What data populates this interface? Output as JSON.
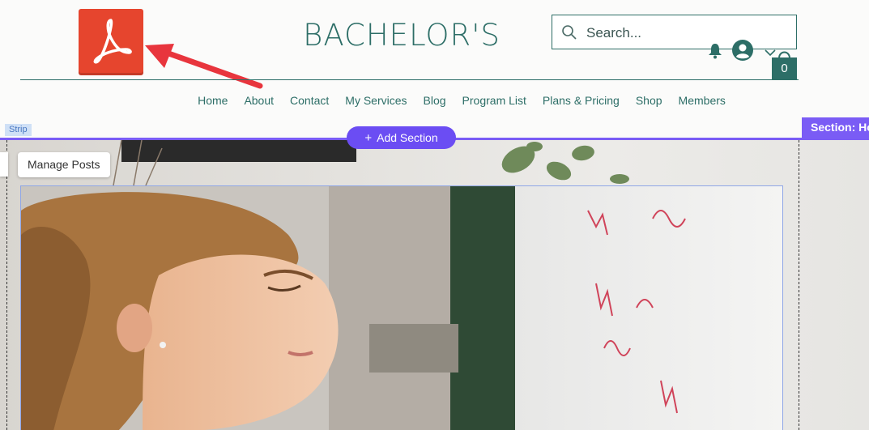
{
  "header": {
    "site_title": "BACHELOR'S",
    "logo_icon": "adobe-acrobat-pdf-icon",
    "search": {
      "placeholder": "Search...",
      "value": ""
    },
    "cart_count": "0",
    "nav": [
      "Home",
      "About",
      "Contact",
      "My Services",
      "Blog",
      "Program List",
      "Plans & Pricing",
      "Shop",
      "Members"
    ]
  },
  "editor": {
    "strip_label": "Strip",
    "add_section_label": "Add Section",
    "section_label": "Section: Ho",
    "manage_posts_label": "Manage Posts"
  },
  "colors": {
    "brand": "#2d6e67",
    "logo_red": "#e6452e",
    "editor_purple": "#6b4df3",
    "arrow_red": "#e8353d"
  }
}
